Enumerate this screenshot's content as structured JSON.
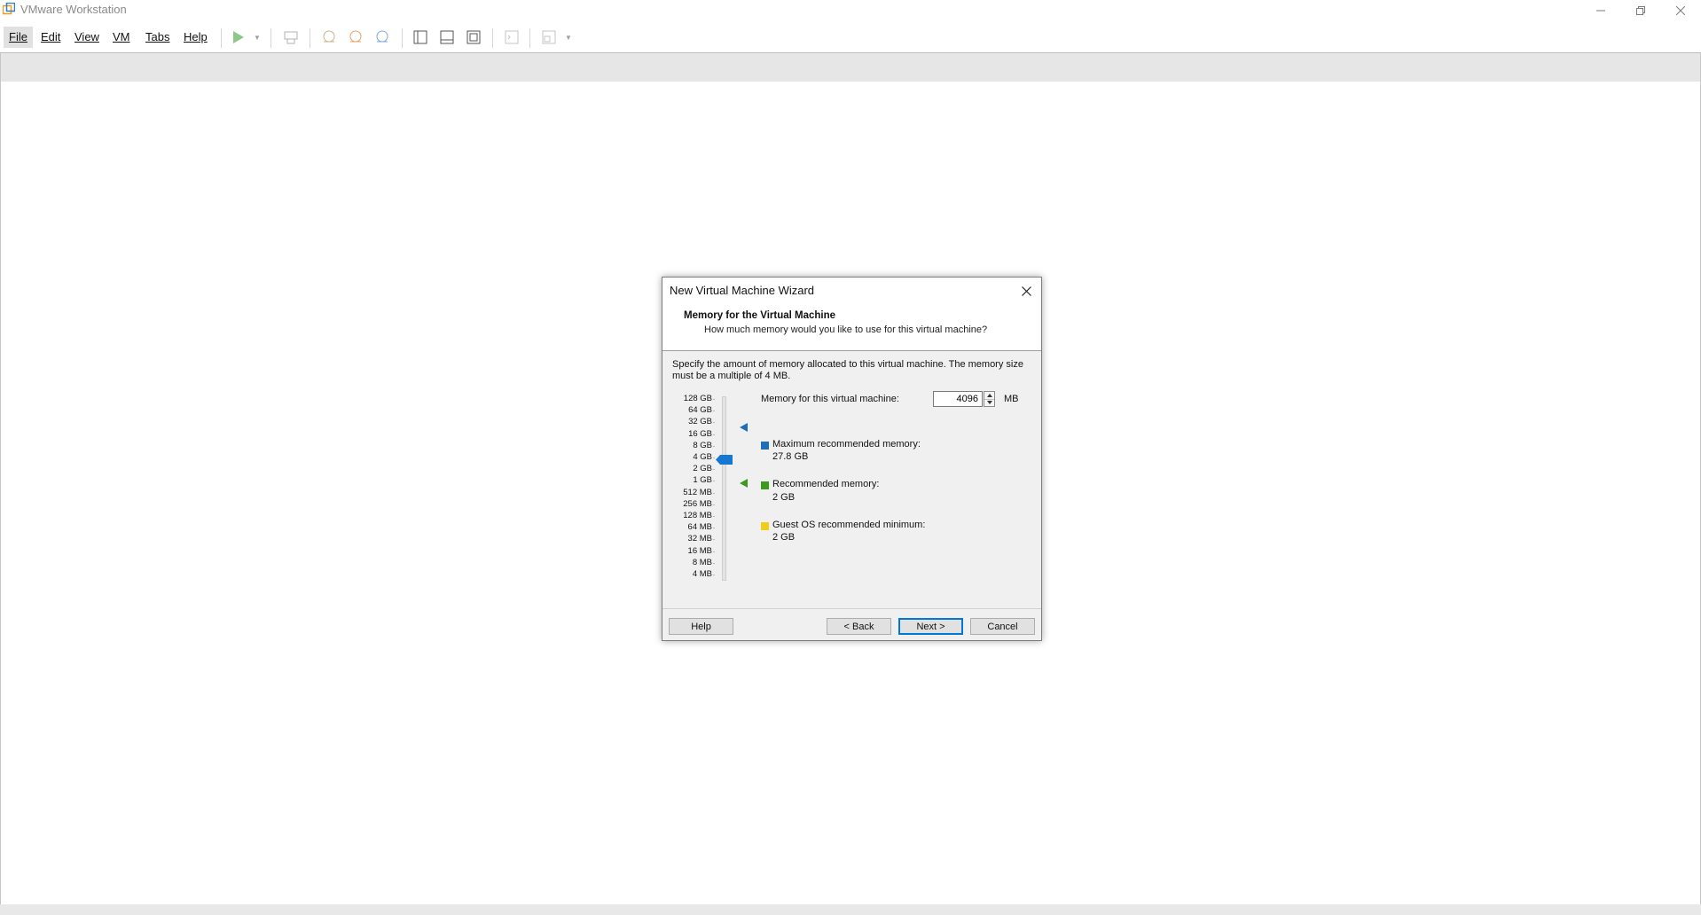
{
  "window": {
    "title": "VMware Workstation"
  },
  "menu": {
    "file": "File",
    "edit": "Edit",
    "view": "View",
    "vm": "VM",
    "tabs": "Tabs",
    "help": "Help"
  },
  "toolbar_icons": [
    "power-on-icon",
    "send-ctrl-alt-del-icon",
    "snapshot-icon",
    "revert-snapshot-icon",
    "snapshot-manager-icon",
    "library-view-icon",
    "thumbnail-bar-icon",
    "full-screen-icon",
    "console-view-icon",
    "unity-icon"
  ],
  "dialog": {
    "title": "New Virtual Machine Wizard",
    "heading": "Memory for the Virtual Machine",
    "subheading": "How much memory would you like to use for this virtual machine?",
    "description": "Specify the amount of memory allocated to this virtual machine. The memory size must be a multiple of 4 MB.",
    "scale_labels": [
      "128 GB",
      "64 GB",
      "32 GB",
      "16 GB",
      "8 GB",
      "4 GB",
      "2 GB",
      "1 GB",
      "512 MB",
      "256 MB",
      "128 MB",
      "64 MB",
      "32 MB",
      "16 MB",
      "8 MB",
      "4 MB"
    ],
    "memory_label": "Memory for this virtual machine:",
    "memory_value": "4096",
    "memory_unit": "MB",
    "legend": {
      "max_title": "Maximum recommended memory:",
      "max_value": "27.8 GB",
      "rec_title": "Recommended memory:",
      "rec_value": "2 GB",
      "min_title": "Guest OS recommended minimum:",
      "min_value": "2 GB"
    },
    "colors": {
      "max": "#1e6fb8",
      "rec": "#3c9a1e",
      "min": "#f2cc1b",
      "thumb": "#1677d2"
    },
    "buttons": {
      "help": "Help",
      "back": "< Back",
      "next": "Next >",
      "cancel": "Cancel"
    }
  }
}
